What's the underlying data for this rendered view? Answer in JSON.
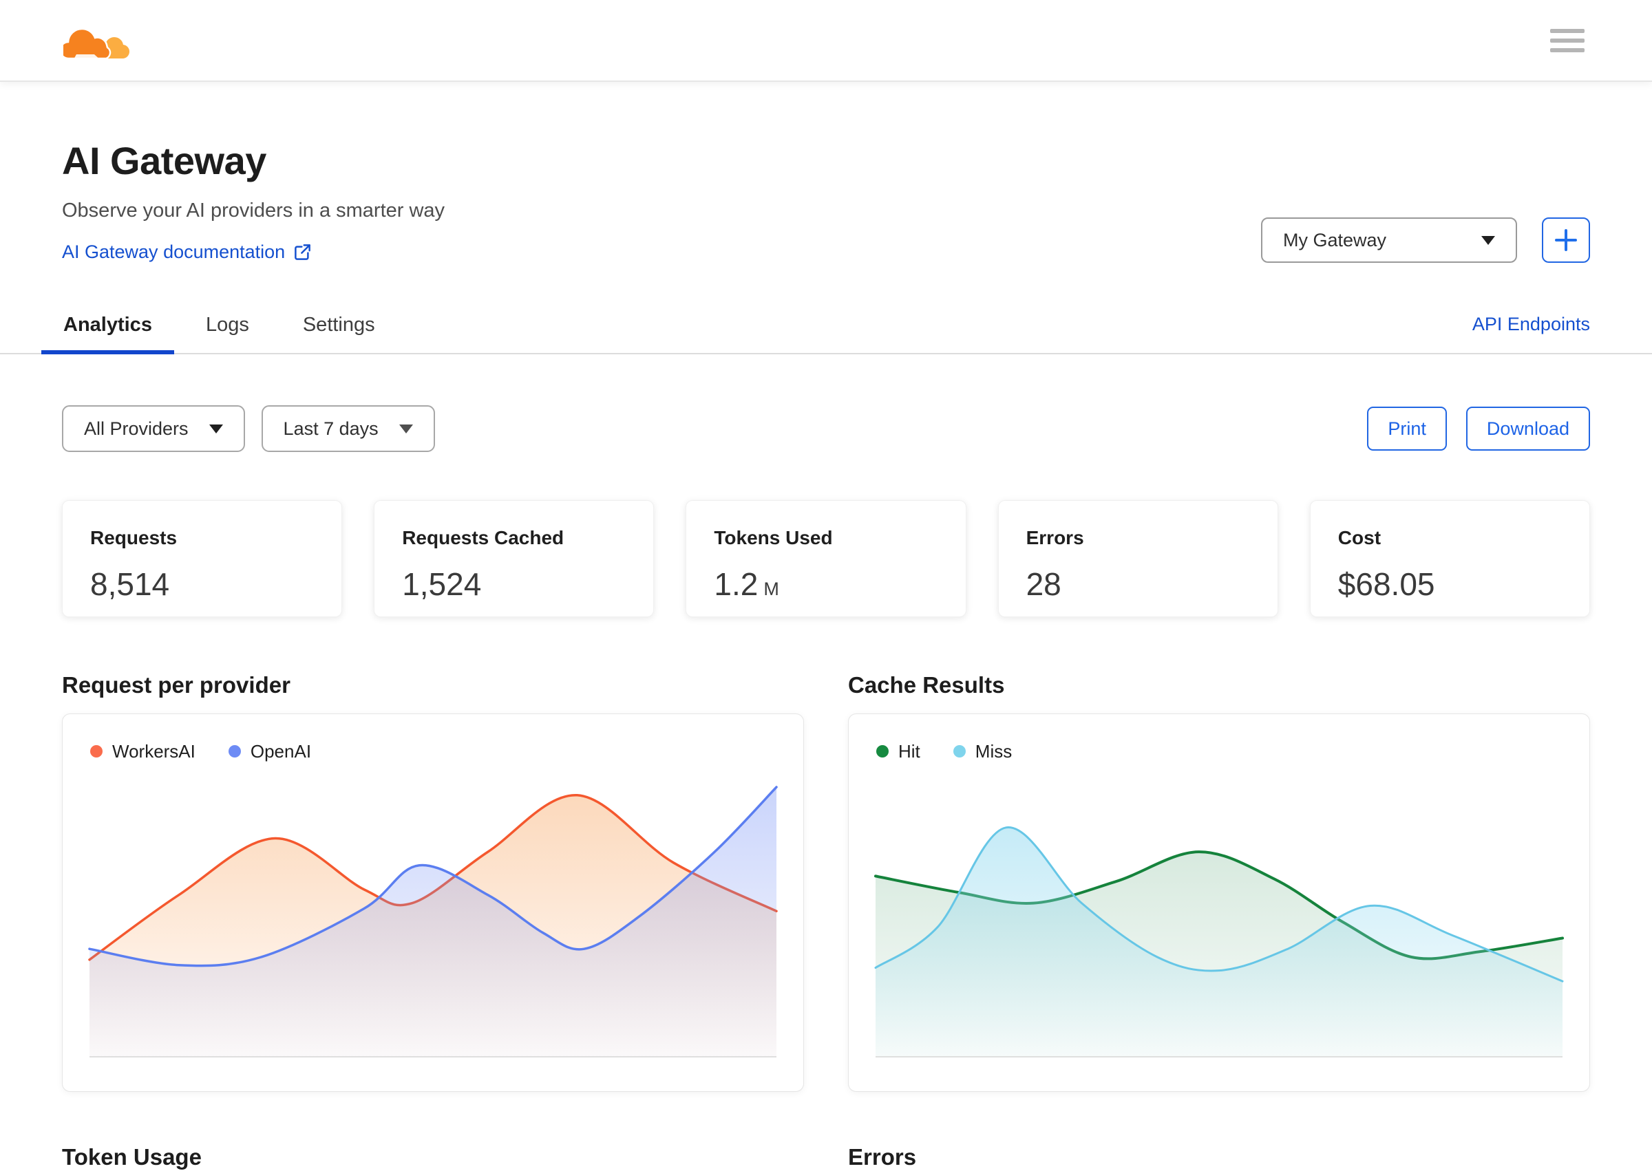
{
  "header": {
    "logo": "cloudflare-logo",
    "menu": "hamburger-menu"
  },
  "page": {
    "title": "AI Gateway",
    "subtitle": "Observe your AI providers in a smarter way",
    "doc_link_label": "AI Gateway documentation",
    "gateway_selected": "My Gateway",
    "add_gateway_label": "+",
    "api_endpoints_label": "API Endpoints",
    "tabs": [
      {
        "label": "Analytics",
        "active": true
      },
      {
        "label": "Logs",
        "active": false
      },
      {
        "label": "Settings",
        "active": false
      }
    ]
  },
  "toolbar": {
    "provider_filter": "All Providers",
    "range_filter": "Last 7 days",
    "print_label": "Print",
    "download_label": "Download"
  },
  "stats": [
    {
      "label": "Requests",
      "value": "8,514",
      "suffix": ""
    },
    {
      "label": "Requests Cached",
      "value": "1,524",
      "suffix": ""
    },
    {
      "label": "Tokens Used",
      "value": "1.2",
      "suffix": "M"
    },
    {
      "label": "Errors",
      "value": "28",
      "suffix": ""
    },
    {
      "label": "Cost",
      "value": "$68.05",
      "suffix": ""
    }
  ],
  "colors": {
    "brand_orange": "#f6821f",
    "brand_orange_light": "#fbad41",
    "link_blue": "#1550cf",
    "action_blue": "#2166e3",
    "tab_underline_blue": "#1246cc"
  },
  "chart_data": [
    {
      "id": "request-per-provider",
      "type": "area",
      "title": "Request per provider",
      "legend_position": "top-left",
      "x_range": [
        0,
        100
      ],
      "y_range": [
        0,
        100
      ],
      "grid": false,
      "series": [
        {
          "name": "WorkersAI",
          "color": "#f4582e",
          "dot": "#fa6c4c",
          "fill": "#f79a4e",
          "fill_opacity": 0.38,
          "stroke_width": 3.5,
          "points": [
            [
              0,
              36
            ],
            [
              13,
              60
            ],
            [
              27,
              81
            ],
            [
              40,
              62
            ],
            [
              47,
              57
            ],
            [
              58,
              76
            ],
            [
              71,
              97
            ],
            [
              85,
              72
            ],
            [
              100,
              54
            ]
          ]
        },
        {
          "name": "OpenAI",
          "color": "#5b7ef0",
          "dot": "#6d8bf5",
          "fill": "#7b95f5",
          "fill_opacity": 0.4,
          "stroke_width": 3.5,
          "points": [
            [
              0,
              40
            ],
            [
              13,
              34
            ],
            [
              25,
              37
            ],
            [
              40,
              55
            ],
            [
              48,
              71
            ],
            [
              58,
              60
            ],
            [
              66,
              46
            ],
            [
              72,
              40
            ],
            [
              80,
              52
            ],
            [
              91,
              76
            ],
            [
              100,
              100
            ]
          ]
        }
      ]
    },
    {
      "id": "cache-results",
      "type": "area",
      "title": "Cache Results",
      "legend_position": "top-left",
      "x_range": [
        0,
        100
      ],
      "y_range": [
        0,
        100
      ],
      "grid": false,
      "series": [
        {
          "name": "Hit",
          "color": "#15833c",
          "dot": "#168a40",
          "fill": "#4a9e6b",
          "fill_opacity": 0.22,
          "stroke_width": 4,
          "points": [
            [
              0,
              67
            ],
            [
              12,
              61
            ],
            [
              23,
              57
            ],
            [
              35,
              65
            ],
            [
              47,
              76
            ],
            [
              58,
              66
            ],
            [
              68,
              50
            ],
            [
              78,
              37
            ],
            [
              88,
              39
            ],
            [
              100,
              44
            ]
          ]
        },
        {
          "name": "Miss",
          "color": "#66c6e6",
          "dot": "#7fd4ec",
          "fill": "#8cd7ef",
          "fill_opacity": 0.5,
          "stroke_width": 3,
          "points": [
            [
              0,
              33
            ],
            [
              9,
              48
            ],
            [
              19,
              85
            ],
            [
              30,
              57
            ],
            [
              41,
              37
            ],
            [
              50,
              32
            ],
            [
              60,
              40
            ],
            [
              72,
              56
            ],
            [
              84,
              45
            ],
            [
              100,
              28
            ]
          ]
        }
      ]
    },
    {
      "id": "token-usage",
      "type": "area",
      "title": "Token Usage"
    },
    {
      "id": "errors",
      "type": "area",
      "title": "Errors"
    }
  ]
}
